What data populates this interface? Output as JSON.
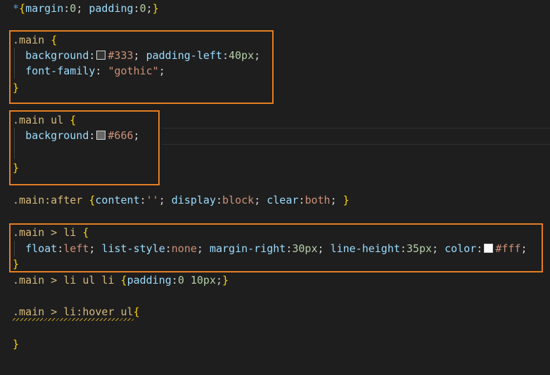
{
  "code": {
    "line1": {
      "star": "*",
      "brace_open": "{",
      "p1": "margin",
      "v1": "0",
      "p2": "padding",
      "v2": "0",
      "brace_close": "}"
    },
    "block_main": {
      "selector": ".main",
      "brace_open": "{",
      "prop_background": "background",
      "val_background": "#333",
      "prop_padding": "padding-left",
      "val_padding": "40px",
      "prop_font": "font-family",
      "val_font": "\"gothic\"",
      "brace_close": "}"
    },
    "block_main_ul": {
      "selector": ".main ul",
      "brace_open": "{",
      "prop_background": "background",
      "val_background": "#666",
      "brace_close": "}"
    },
    "line_after": {
      "selector": ".main:after",
      "brace_open": "{",
      "p1": "content",
      "v1": "''",
      "p2": "display",
      "v2": "block",
      "p3": "clear",
      "v3": "both",
      "brace_close": "}"
    },
    "block_li": {
      "selector": ".main > li",
      "brace_open": "{",
      "p1": "float",
      "v1": "left",
      "p2": "list-style",
      "v2": "none",
      "p3": "margin-right",
      "v3": "30px",
      "p4": "line-height",
      "v4": "35px",
      "p5": "color",
      "v5": "#fff",
      "brace_close": "}"
    },
    "line_li_ul": {
      "selector": ".main > li ul li",
      "brace_open": "{",
      "p1": "padding",
      "v1": "0 10px",
      "brace_close": "}"
    },
    "block_hover": {
      "selector": ".main > li:hover ul",
      "brace_open": "{",
      "brace_close": "}"
    }
  },
  "colors": {
    "swatch_333": "#333333",
    "swatch_666": "#666666",
    "swatch_fff": "#ffffff",
    "highlight_box": "#e67e22"
  }
}
